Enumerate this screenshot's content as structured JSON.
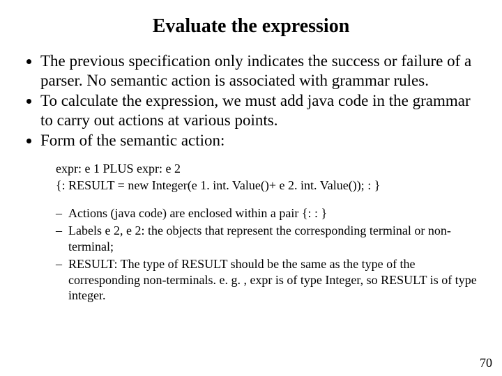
{
  "title": "Evaluate the expression",
  "bullets": {
    "b1": "The previous specification only indicates the success or failure of a parser. No semantic action is associated with grammar rules.",
    "b2": "To calculate the expression, we must add java code in the grammar to carry out actions at various points.",
    "b3": "Form of the semantic action:"
  },
  "code": {
    "line1": "expr: e 1 PLUS expr: e 2",
    "line2": "{: RESULT = new Integer(e 1. int. Value()+ e 2. int. Value());    : }"
  },
  "sub": {
    "s1": "Actions (java code) are enclosed within a pair {:   : }",
    "s2": "Labels e 2, e 2: the objects that represent the corresponding terminal or non-terminal;",
    "s3": "RESULT:  The type of RESULT should be the same as the type of the corresponding non-terminals. e. g. , expr is of type Integer, so RESULT is of type integer."
  },
  "page": "70"
}
